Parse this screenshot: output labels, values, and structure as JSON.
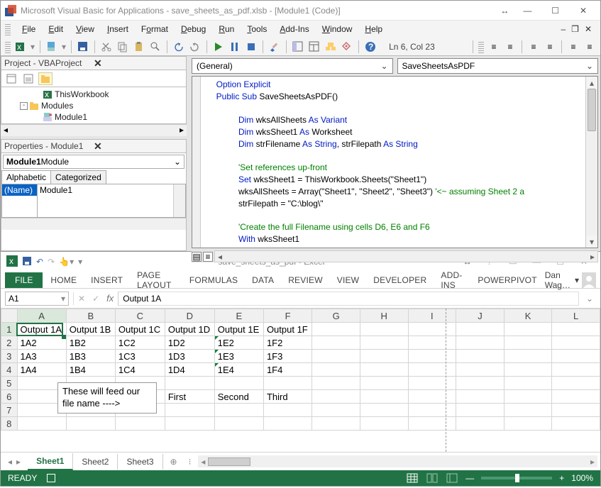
{
  "vba": {
    "title": "Microsoft Visual Basic for Applications - save_sheets_as_pdf.xlsb - [Module1 (Code)]",
    "menus": [
      "File",
      "Edit",
      "View",
      "Insert",
      "Format",
      "Debug",
      "Run",
      "Tools",
      "Add-Ins",
      "Window",
      "Help"
    ],
    "ln_col": "Ln 6, Col 23",
    "project": {
      "header": "Project - VBAProject",
      "tree": {
        "thisworkbook": "ThisWorkbook",
        "modules": "Modules",
        "module1": "Module1"
      }
    },
    "properties": {
      "header": "Properties - Module1",
      "combo_bold": "Module1",
      "combo_rest": " Module",
      "tabs": {
        "a": "Alphabetic",
        "c": "Categorized"
      },
      "row_label": "(Name)",
      "row_value": "Module1"
    },
    "combo_left": "(General)",
    "combo_right": "SaveSheetsAsPDF",
    "code": {
      "l1_kw": "Option Explicit",
      "l2_kw": "Public Sub",
      "l2_tx": " SaveSheetsAsPDF()",
      "l4_kw1": "Dim",
      "l4_tx1": " wksAllSheets ",
      "l4_kw2": "As Variant",
      "l5_kw1": "Dim",
      "l5_tx1": " wksSheet1 ",
      "l5_kw2": "As",
      "l5_tx2": " Worksheet",
      "l6_kw1": "Dim",
      "l6_tx1": " strFilename ",
      "l6_kw2": "As String",
      "l6_tx2": ", strFilepath ",
      "l6_kw3": "As String",
      "l8_cm": "'Set references up-front",
      "l9_kw1": "Set",
      "l9_tx1": " wksSheet1 = ThisWorkbook.Sheets(\"Sheet1\")",
      "l10_tx": "wksAllSheets = Array(\"Sheet1\", \"Sheet2\", \"Sheet3\") ",
      "l10_cm": "'<~ assuming Sheet 2 a",
      "l11_tx": "strFilepath = \"C:\\blog\\\"",
      "l13_cm": "'Create the full Filename using cells D6, E6 and F6",
      "l14_kw1": "With",
      "l14_tx1": " wksSheet1"
    }
  },
  "excel": {
    "title": "save_sheets_as_pdf - Excel",
    "tabs": {
      "file": "FILE",
      "items": [
        "HOME",
        "INSERT",
        "PAGE LAYOUT",
        "FORMULAS",
        "DATA",
        "REVIEW",
        "VIEW",
        "DEVELOPER",
        "ADD-INS",
        "POWERPIVOT"
      ]
    },
    "user": "Dan Wag…",
    "namebox": "A1",
    "formula": "Output 1A",
    "columns": [
      "A",
      "B",
      "C",
      "D",
      "E",
      "F",
      "G",
      "H",
      "I",
      "J",
      "K",
      "L"
    ],
    "rows": [
      {
        "n": "1",
        "c": [
          "Output 1A",
          "Output 1B",
          "Output 1C",
          "Output 1D",
          "Output 1E",
          "Output 1F",
          "",
          "",
          "",
          "",
          "",
          ""
        ]
      },
      {
        "n": "2",
        "c": [
          "1A2",
          "1B2",
          "1C2",
          "1D2",
          "1E2",
          "1F2",
          "",
          "",
          "",
          "",
          "",
          ""
        ]
      },
      {
        "n": "3",
        "c": [
          "1A3",
          "1B3",
          "1C3",
          "1D3",
          "1E3",
          "1F3",
          "",
          "",
          "",
          "",
          "",
          ""
        ]
      },
      {
        "n": "4",
        "c": [
          "1A4",
          "1B4",
          "1C4",
          "1D4",
          "1E4",
          "1F4",
          "",
          "",
          "",
          "",
          "",
          ""
        ]
      },
      {
        "n": "5",
        "c": [
          "",
          "",
          "",
          "",
          "",
          "",
          "",
          "",
          "",
          "",
          "",
          ""
        ]
      },
      {
        "n": "6",
        "c": [
          "",
          "",
          "",
          "First",
          "Second",
          "Third",
          "",
          "",
          "",
          "",
          "",
          ""
        ]
      },
      {
        "n": "7",
        "c": [
          "",
          "",
          "",
          "",
          "",
          "",
          "",
          "",
          "",
          "",
          "",
          ""
        ]
      },
      {
        "n": "8",
        "c": [
          "",
          "",
          "",
          "",
          "",
          "",
          "",
          "",
          "",
          "",
          "",
          ""
        ]
      }
    ],
    "annotation": "These will feed our\nfile name ---->",
    "sheets": {
      "s1": "Sheet1",
      "s2": "Sheet2",
      "s3": "Sheet3"
    },
    "status": "READY",
    "zoom": "100%"
  }
}
